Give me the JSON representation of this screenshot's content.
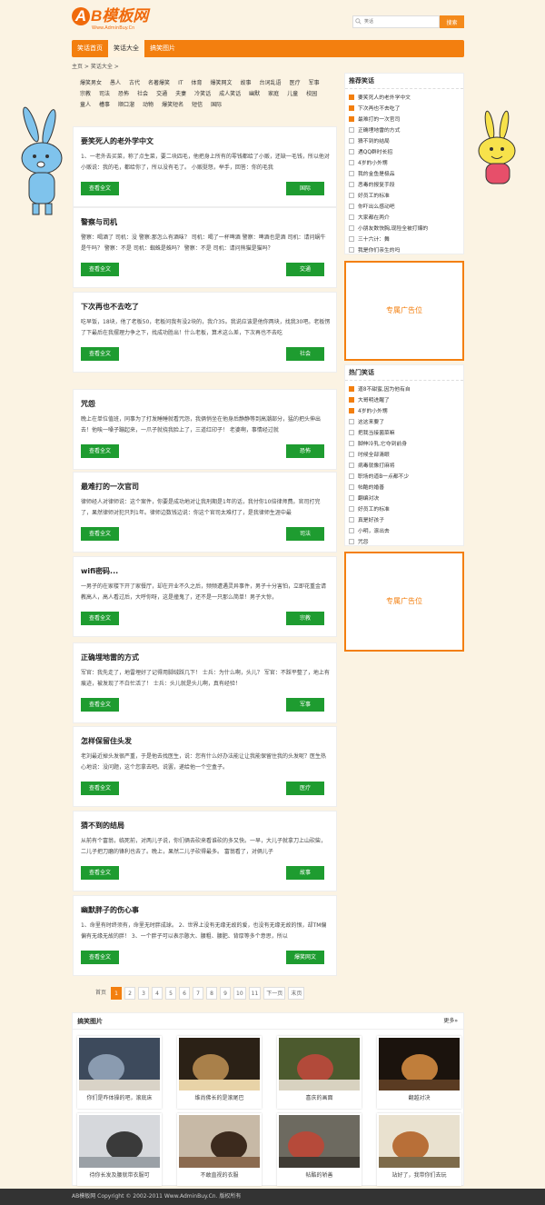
{
  "brand": {
    "logo_text": "AB模板网",
    "logo_letter": "A",
    "logo_rest": "B模板网",
    "logo_sub": "Www.AdminBuy.Cn"
  },
  "search": {
    "placeholder": "笑话",
    "button": "搜索",
    "icon": "search-icon"
  },
  "nav": [
    {
      "label": "笑话首页",
      "active": false
    },
    {
      "label": "笑话大全",
      "active": true
    },
    {
      "label": "搞笑图片",
      "active": false
    }
  ],
  "breadcrumb": "主页 > 笑话大全 >",
  "tags": [
    "爆笑男女",
    "愚人",
    "古代",
    "名著爆笑",
    "IT",
    "体育",
    "爆笑网文",
    "故事",
    "台词乱语",
    "医疗",
    "军事",
    "宗教",
    "司法",
    "恐怖",
    "社会",
    "交通",
    "夫妻",
    "冷笑话",
    "成人笑话",
    "幽默",
    "家庭",
    "儿童",
    "校园",
    "童人",
    "槽事",
    "顺口溜",
    "动物",
    "爆笑短名",
    "短信",
    "国际"
  ],
  "jokes": [
    {
      "title": "要笑死人的老外学中文",
      "text": "1、一老外去买菜，称了点生菜，要二块四毛，他把身上所有的零钱都给了小贩，还缺一毛钱，所以他对小贩说：我的毛，都给你了，所以没有毛了。 小贩挺怒，举手，回答：你的毛我",
      "read": "查看全文",
      "tag": "国际"
    },
    {
      "title": "警察与司机",
      "text": "警察：喝酒了 司机：没 警察:那怎么有酒味？ 司机：喝了一杯啤酒 警察：啤酒也是酒 司机：请问蜗牛是牛吗？ 警察：不是 司机：蜘蛛是蛛吗？ 警察：不是 司机：请问熊猫是猫吗？",
      "read": "查看全文",
      "tag": "交通"
    },
    {
      "title": "下次再也不去吃了",
      "text": "吃早饭，18块，他了老板50，老板问我有没2块的，我介35。我说应该是他你两块，找我30吧。老板愣了下最后在我摆理力争之下，找成功胜出！什么老板，算术这么差，下次再也不去吃",
      "read": "查看全文",
      "tag": "社会"
    },
    {
      "title": "咒怨",
      "text": "晚上在单位值班，同事为了打发睡睡就看咒怨，我俩悄坐在他身后静静等到高潮部分，猛的把头伸出去！他唉一嗓子蹦起来，一爪子就挠我脸上了，三道红印子！ 老婆啊，事情经过就",
      "read": "查看全文",
      "tag": "恐怖"
    },
    {
      "title": "最难打的一次官司",
      "text": "律师经人对律师说：这个案件，你要是成功地对让我刑期是1年的话，我付你10倍律师费。官司打完了，果然律师对犯只判1年。律师边数钱边说：你这个官司太难打了，是我律师生涯中最",
      "read": "查看全文",
      "tag": "司法"
    },
    {
      "title": "wifi密码...",
      "text": "一男子的在家楼下开了家餐厅，却在开业不久之后，频频遭遇灵异事件，男子十分害怕，立即花重金请教高人，高人看过后，大呼你呀，这是撞鬼了，还不是一只那么简单！男子大惊，",
      "read": "查看全文",
      "tag": "宗教"
    },
    {
      "title": "正确埋地雷的方式",
      "text": "军官：我先走了，地雷埋好了记得用脚绒踩几下！ 士兵：为什么啊，头儿？ 军官：不踩平整了，地上有痕迹，被发现了不白忙活了！ 士兵：头儿就是头儿啊，真有经验！",
      "read": "查看全文",
      "tag": "军事"
    },
    {
      "title": "怎样保留住头发",
      "text": "老刘最近掉头发很严重，于是他去找医生，说：您有什么好办法能让让我能保留住我的头发呢？医生热心地说：没问题，这个您拿去吧。说罢，递给他一个空盒子。",
      "read": "查看全文",
      "tag": "医疗"
    },
    {
      "title": "猜不到的结局",
      "text": "从前有个富翁，临死前，对两儿子说，你们俩去砍来看谁砍的多又快。一早，大儿子就拿刀上山砍柴，二儿子把刀磨的锋利也去了。晚上，果然二儿子砍得最多。 富翁看了，对俩儿子",
      "read": "查看全文",
      "tag": "故事"
    },
    {
      "title": "幽默胖子的伤心事",
      "text": "1、命里有时终须有，命里无时胖成球。 2、世界上没有无缘无故的爱，也没有无缘无故的恨，却TM偏偏有无缘无故的胖！ 3、一个胖子可以表示憨大、腰粗、腰肥、背厚等多个意思，所以",
      "read": "查看全文",
      "tag": "爆笑网文"
    }
  ],
  "recommend": {
    "title": "推荐笑话",
    "items": [
      "要笑死人的老外学中文",
      "下次再也不去吃了",
      "最难打的一次官司",
      "正确埋地雷的方式",
      "猜不到的结局",
      "遇QQ群时长招",
      "4岁的小外甥",
      "我的金鱼是极品",
      "恶毒的报复手段",
      "好员工的标准",
      "你吓出么感动吧",
      "大家都在两介",
      "小朋友数快胸,现险全被打爆的",
      "三十六计：舞",
      "我是你们亲生的吗"
    ]
  },
  "ad1": "专属广告位",
  "hot": {
    "title": "热门笑话",
    "items": [
      "道8不甜蜜,因为他有自",
      "大哥明进醒了",
      "4岁的小外甥",
      "这这来要了",
      "把我当接菌菜嘛",
      "脚伸冷乳,它夺到前身",
      "时候全部清眼",
      "病毒就像打麻将",
      "职场的道B一点都不少",
      "帖酷的婚善",
      "翻编对决",
      "好员工的标准",
      "真是好孩子",
      "小明，滚出去",
      "咒怨"
    ]
  },
  "ad2": "专属广告位",
  "pager": [
    "首页",
    "1",
    "2",
    "3",
    "4",
    "5",
    "6",
    "7",
    "8",
    "9",
    "10",
    "11",
    "下一页",
    "末页"
  ],
  "pager_current": "1",
  "gallery": {
    "title": "搞笑图片",
    "more": "更多»",
    "items": [
      {
        "caption": "你们是咋体操的吧，滚底床"
      },
      {
        "caption": "维尚佛长的是滚尾巴"
      },
      {
        "caption": "喜庆的画面"
      },
      {
        "caption": "翻越对决"
      },
      {
        "caption": "待你长发及腰就带衣服可"
      },
      {
        "caption": "不敢直视的衣服"
      },
      {
        "caption": "帖酷的轿善"
      },
      {
        "caption": "站好了，我带你们去玩"
      }
    ]
  },
  "footer": "AB模板网 Copyright © 2002-2011 Www.AdminBuy.Cn. 版权所有",
  "colors": {
    "orange": "#f37f0f",
    "green": "#1e9c30",
    "bg": "#fbf3e3"
  }
}
